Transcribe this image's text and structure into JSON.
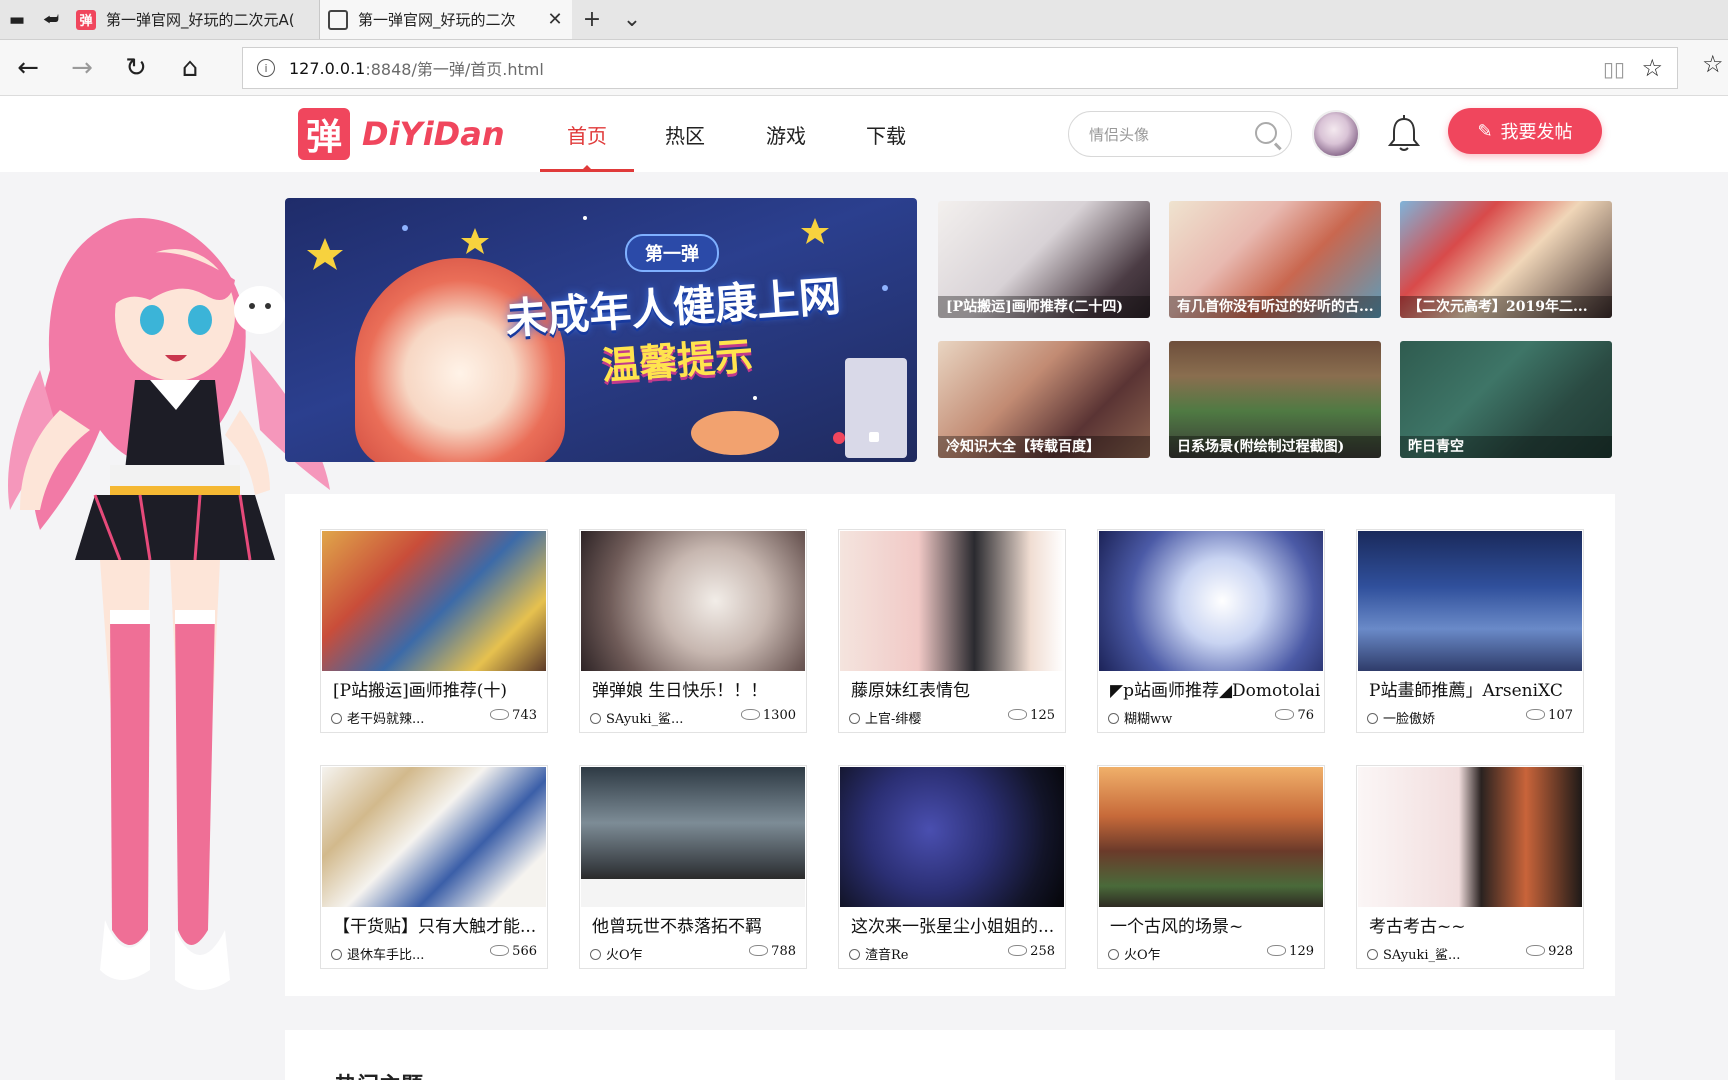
{
  "browser": {
    "tabs": [
      {
        "title": "第一弹官网_好玩的二次元A(",
        "active": false,
        "favicon": "brand"
      },
      {
        "title": "第一弹官网_好玩的二次",
        "active": true,
        "favicon": "page"
      }
    ],
    "url_host": "127.0.0.1",
    "url_rest": ":8848/第一弹/首页.html"
  },
  "site": {
    "logo_char": "弹",
    "logo_text": "DiYiDan",
    "nav": [
      "首页",
      "热区",
      "游戏",
      "下载"
    ],
    "active_nav": "首页",
    "search_placeholder": "情侣头像",
    "post_button": "我要发帖",
    "brand_color": "#f0465d"
  },
  "banner": {
    "badge": "第一弹",
    "headline": "未成年人健康上网",
    "subline": "温馨提示",
    "slide_count": 2,
    "active_slide": 1
  },
  "thumbs": [
    {
      "caption": "[P站搬运]画师推荐(二十四)"
    },
    {
      "caption": "有几首你没有听过的好听的古..."
    },
    {
      "caption": "【二次元高考】2019年二..."
    },
    {
      "caption": "冷知识大全【转载百度】"
    },
    {
      "caption": "日系场景(附绘制过程截图)"
    },
    {
      "caption": "昨日青空"
    }
  ],
  "cards": [
    {
      "title": "[P站搬运]画师推荐(十)",
      "author": "老干妈就辣...",
      "views": "743"
    },
    {
      "title": "弹弹娘 生日快乐！！！",
      "author": "SAyuki_鲨...",
      "views": "1300"
    },
    {
      "title": "藤原妹红表情包",
      "author": "上官-绯樱",
      "views": "125"
    },
    {
      "title": "◤p站画师推荐◢Domotolain",
      "author": "糊糊ww",
      "views": "76"
    },
    {
      "title": "P站畫師推薦」ArseniXC",
      "author": "一脸傲娇",
      "views": "107"
    },
    {
      "title": "【干货贴】只有大触才能...",
      "author": "退休车手比...",
      "views": "566"
    },
    {
      "title": "他曾玩世不恭落拓不羁",
      "author": "火O乍",
      "views": "788"
    },
    {
      "title": "这次来一张星尘小姐姐的...",
      "author": "渣音Re",
      "views": "258"
    },
    {
      "title": "一个古风的场景~",
      "author": "火O乍",
      "views": "129"
    },
    {
      "title": "考古考古~~",
      "author": "SAyuki_鲨...",
      "views": "928"
    }
  ],
  "section_title": "热门主题"
}
